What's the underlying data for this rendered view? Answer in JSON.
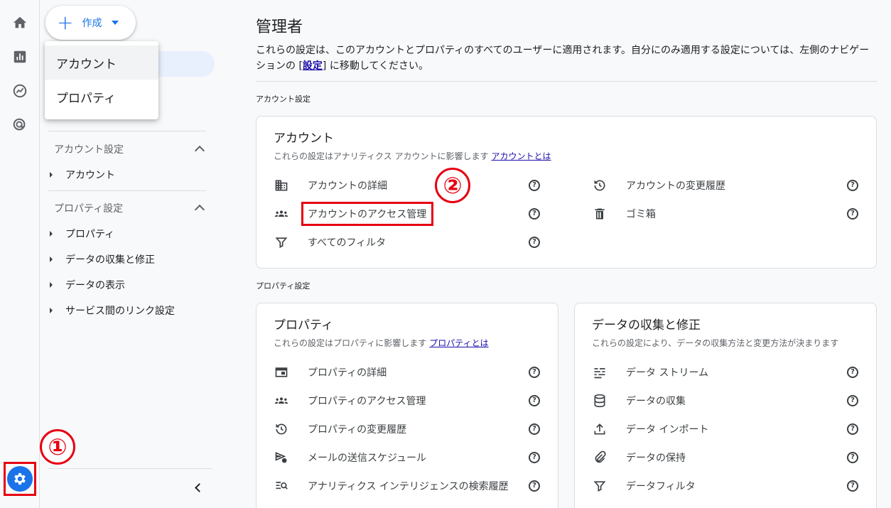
{
  "create": {
    "label": "作成"
  },
  "create_menu": {
    "items": [
      "アカウント",
      "プロパティ"
    ]
  },
  "sidenav": {
    "account_section": "アカウント設定",
    "account_items": [
      "アカウント"
    ],
    "property_section": "プロパティ設定",
    "property_items": [
      "プロパティ",
      "データの収集と修正",
      "データの表示",
      "サービス間のリンク設定"
    ]
  },
  "annotations": {
    "one": "①",
    "two": "②"
  },
  "main": {
    "title": "管理者",
    "desc_pre": "これらの設定は、このアカウントとプロパティのすべてのユーザーに適用されます。自分にのみ適用する設定については、左側のナビゲーションの [",
    "desc_link": "設定",
    "desc_post": "] に移動してください。",
    "account_settings_label": "アカウント設定",
    "property_settings_label": "プロパティ設定"
  },
  "account_card": {
    "title": "アカウント",
    "subtitle": "これらの設定はアナリティクス アカウントに影響します",
    "link": "アカウントとは",
    "left_rows": [
      "アカウントの詳細",
      "アカウントのアクセス管理",
      "すべてのフィルタ"
    ],
    "right_rows": [
      "アカウントの変更履歴",
      "ゴミ箱"
    ]
  },
  "property_card": {
    "title": "プロパティ",
    "subtitle": "これらの設定はプロパティに影響します",
    "link": "プロパティとは",
    "rows": [
      "プロパティの詳細",
      "プロパティのアクセス管理",
      "プロパティの変更履歴",
      "メールの送信スケジュール",
      "アナリティクス インテリジェンスの検索履歴"
    ]
  },
  "data_card": {
    "title": "データの収集と修正",
    "subtitle": "これらの設定により、データの収集方法と変更方法が決まります",
    "rows": [
      "データ ストリーム",
      "データの収集",
      "データ インポート",
      "データの保持",
      "データフィルタ"
    ]
  },
  "help_glyph": "?",
  "colors": {
    "accent": "#1a73e8",
    "annotation": "#e60012"
  }
}
